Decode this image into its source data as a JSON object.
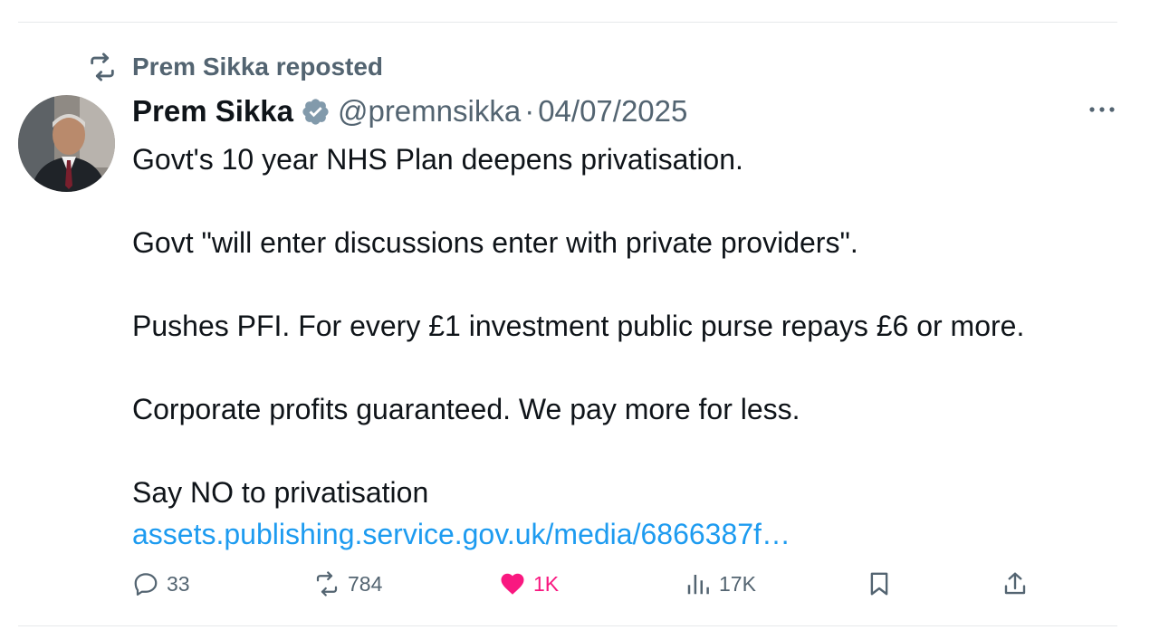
{
  "repost": {
    "label": "Prem Sikka reposted",
    "icon": "repost-icon"
  },
  "author": {
    "name": "Prem Sikka",
    "verified": true,
    "handle": "@premnsikka",
    "separator": "·",
    "date": "04/07/2025"
  },
  "tweet": {
    "lines": [
      "Govt's 10 year NHS Plan deepens privatisation.",
      "",
      "Govt \"will enter discussions enter with private providers\".",
      "",
      "Pushes PFI.  For every £1 investment public purse repays £6 or more.",
      "",
      "Corporate profits guaranteed. We pay more for less.",
      "",
      "Say NO to privatisation"
    ],
    "link_text": "assets.publishing.service.gov.uk/media/6866387f…"
  },
  "actions": {
    "replies": "33",
    "reposts": "784",
    "likes": "1K",
    "views": "17K"
  },
  "colors": {
    "muted": "#536471",
    "link": "#1d9bf0",
    "like": "#f91880",
    "text": "#0f1419"
  }
}
